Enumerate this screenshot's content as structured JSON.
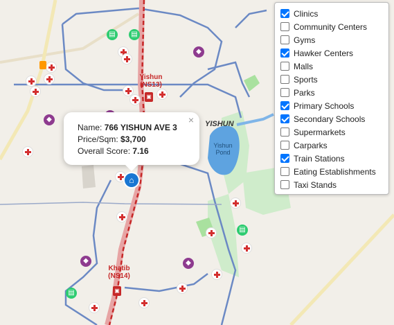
{
  "map": {
    "area_label": "YISHUN",
    "pond_label": "Yishun Pond",
    "stations": [
      {
        "name": "Yishun",
        "code": "(NS13)"
      },
      {
        "name": "Khatib",
        "code": "(NS14)"
      }
    ]
  },
  "popup": {
    "name_label": "Name: ",
    "name_value": "766 YISHUN AVE 3",
    "price_label": "Price/Sqm: ",
    "price_value": "$3,700",
    "score_label": "Overall Score: ",
    "score_value": "7.16",
    "close_icon": "×"
  },
  "layers": [
    {
      "label": "Clinics",
      "checked": true
    },
    {
      "label": "Community Centers",
      "checked": false
    },
    {
      "label": "Gyms",
      "checked": false
    },
    {
      "label": "Hawker Centers",
      "checked": true
    },
    {
      "label": "Malls",
      "checked": false
    },
    {
      "label": "Sports",
      "checked": false
    },
    {
      "label": "Parks",
      "checked": false
    },
    {
      "label": "Primary Schools",
      "checked": true
    },
    {
      "label": "Secondary Schools",
      "checked": true
    },
    {
      "label": "Supermarkets",
      "checked": false
    },
    {
      "label": "Carparks",
      "checked": false
    },
    {
      "label": "Train Stations",
      "checked": true
    },
    {
      "label": "Eating Establishments",
      "checked": false
    },
    {
      "label": "Taxi Stands",
      "checked": false
    }
  ],
  "colors": {
    "clinic": "#d32f2f",
    "rail": "#c62828",
    "road": "#6b89c4",
    "park": "#b9e6b0",
    "water": "#5ea3e0"
  }
}
